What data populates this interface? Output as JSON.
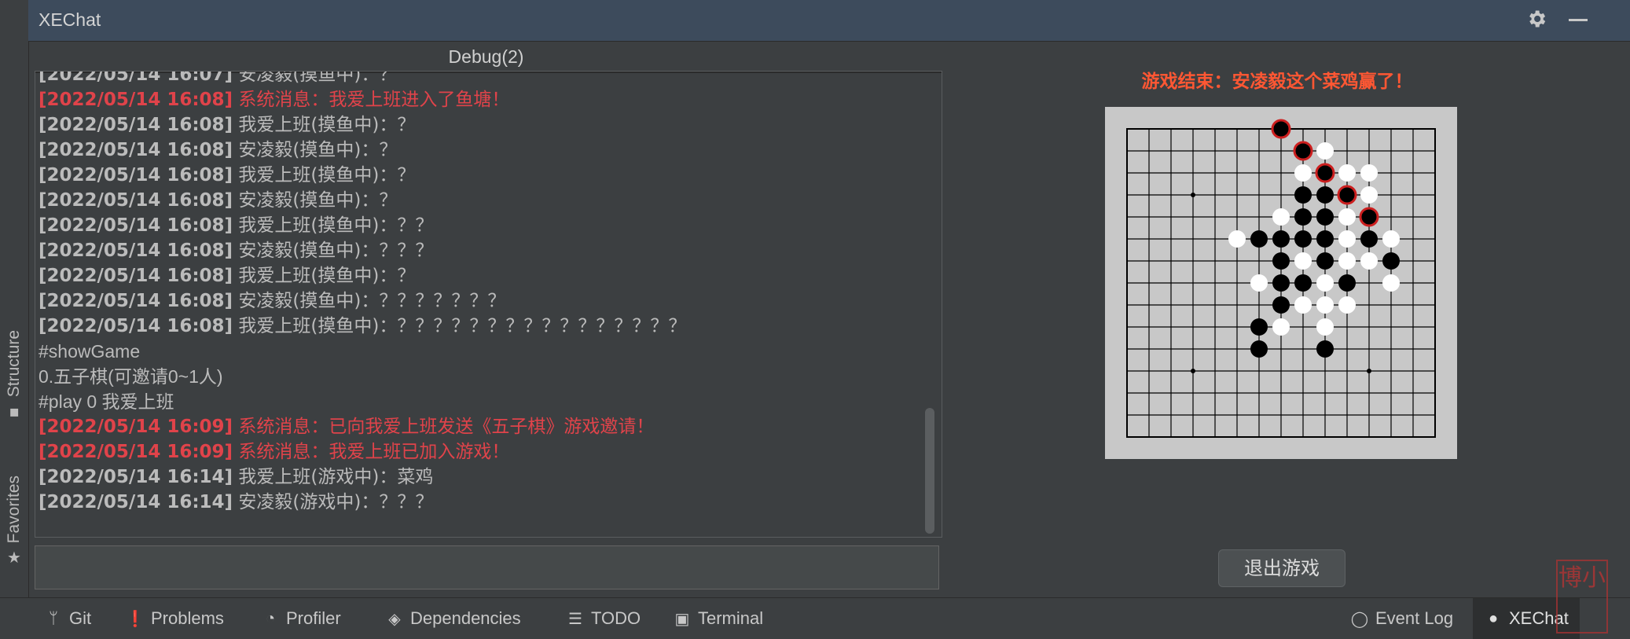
{
  "window": {
    "title": "XEChat"
  },
  "left_stripe": {
    "structure_label": "Structure",
    "favorites_label": "Favorites"
  },
  "chat": {
    "tab_title": "Debug(2)",
    "lines": [
      {
        "ts": "[2022/05/14 16:07]",
        "text": "安凌毅(摸鱼中)：？",
        "system": false
      },
      {
        "ts": "[2022/05/14 16:08]",
        "text": "系统消息：我爱上班进入了鱼塘！",
        "system": true
      },
      {
        "ts": "[2022/05/14 16:08]",
        "text": "我爱上班(摸鱼中)：？",
        "system": false
      },
      {
        "ts": "[2022/05/14 16:08]",
        "text": "安凌毅(摸鱼中)：？",
        "system": false
      },
      {
        "ts": "[2022/05/14 16:08]",
        "text": "我爱上班(摸鱼中)：？",
        "system": false
      },
      {
        "ts": "[2022/05/14 16:08]",
        "text": "安凌毅(摸鱼中)：？",
        "system": false
      },
      {
        "ts": "[2022/05/14 16:08]",
        "text": "我爱上班(摸鱼中)：？？",
        "system": false
      },
      {
        "ts": "[2022/05/14 16:08]",
        "text": "安凌毅(摸鱼中)：？？？",
        "system": false
      },
      {
        "ts": "[2022/05/14 16:08]",
        "text": "我爱上班(摸鱼中)：？",
        "system": false
      },
      {
        "ts": "[2022/05/14 16:08]",
        "text": "安凌毅(摸鱼中)：？？？？？？？",
        "system": false
      },
      {
        "ts": "[2022/05/14 16:08]",
        "text": "我爱上班(摸鱼中)：？？？？？？？？？？？？？？？？",
        "system": false
      },
      {
        "ts": "",
        "text": "#showGame",
        "system": false
      },
      {
        "ts": "",
        "text": "0.五子棋(可邀请0~1人)",
        "system": false
      },
      {
        "ts": "",
        "text": "#play 0 我爱上班",
        "system": false
      },
      {
        "ts": "[2022/05/14 16:09]",
        "text": "系统消息：已向我爱上班发送《五子棋》游戏邀请！",
        "system": true
      },
      {
        "ts": "[2022/05/14 16:09]",
        "text": "系统消息：我爱上班已加入游戏！",
        "system": true
      },
      {
        "ts": "[2022/05/14 16:14]",
        "text": "我爱上班(游戏中)：菜鸡",
        "system": false
      },
      {
        "ts": "[2022/05/14 16:14]",
        "text": "安凌毅(游戏中)：？？？",
        "system": false
      }
    ],
    "input_value": ""
  },
  "game": {
    "status": "游戏结束：安凌毅这个菜鸡赢了！",
    "exit_label": "退出游戏",
    "board": {
      "size": 15,
      "star_points": [
        [
          3,
          3
        ],
        [
          11,
          3
        ],
        [
          3,
          11
        ],
        [
          11,
          11
        ]
      ],
      "winning_line": [
        [
          7,
          0
        ],
        [
          8,
          1
        ],
        [
          9,
          2
        ],
        [
          10,
          3
        ],
        [
          11,
          4
        ]
      ],
      "black": [
        [
          7,
          0
        ],
        [
          8,
          1
        ],
        [
          9,
          2
        ],
        [
          10,
          3
        ],
        [
          11,
          4
        ],
        [
          8,
          3
        ],
        [
          9,
          3
        ],
        [
          8,
          4
        ],
        [
          9,
          4
        ],
        [
          6,
          5
        ],
        [
          7,
          5
        ],
        [
          8,
          5
        ],
        [
          9,
          5
        ],
        [
          11,
          5
        ],
        [
          7,
          6
        ],
        [
          9,
          6
        ],
        [
          12,
          6
        ],
        [
          7,
          7
        ],
        [
          8,
          7
        ],
        [
          10,
          7
        ],
        [
          7,
          8
        ],
        [
          6,
          9
        ],
        [
          6,
          10
        ],
        [
          9,
          10
        ]
      ],
      "white": [
        [
          9,
          1
        ],
        [
          8,
          2
        ],
        [
          10,
          2
        ],
        [
          11,
          2
        ],
        [
          11,
          3
        ],
        [
          7,
          4
        ],
        [
          10,
          4
        ],
        [
          5,
          5
        ],
        [
          10,
          5
        ],
        [
          12,
          5
        ],
        [
          8,
          6
        ],
        [
          10,
          6
        ],
        [
          11,
          6
        ],
        [
          6,
          7
        ],
        [
          9,
          7
        ],
        [
          12,
          7
        ],
        [
          8,
          8
        ],
        [
          9,
          8
        ],
        [
          10,
          8
        ],
        [
          7,
          9
        ],
        [
          9,
          9
        ]
      ]
    },
    "colors": {
      "status": "#ff5733",
      "board_bg": "#c8c8c8",
      "win_ring": "#cc1f1f"
    }
  },
  "bottombar": {
    "tabs": [
      {
        "label": "Git",
        "icon": "git-branch-icon"
      },
      {
        "label": "Problems",
        "icon": "problems-icon"
      },
      {
        "label": "Profiler",
        "icon": "profiler-icon"
      },
      {
        "label": "Dependencies",
        "icon": "dependencies-icon"
      },
      {
        "label": "TODO",
        "icon": "todo-icon"
      },
      {
        "label": "Terminal",
        "icon": "terminal-icon"
      },
      {
        "label": "Event Log",
        "icon": "event-log-icon"
      },
      {
        "label": "XEChat",
        "icon": "xechat-icon"
      }
    ]
  },
  "stamp": {
    "text": "博小文"
  }
}
